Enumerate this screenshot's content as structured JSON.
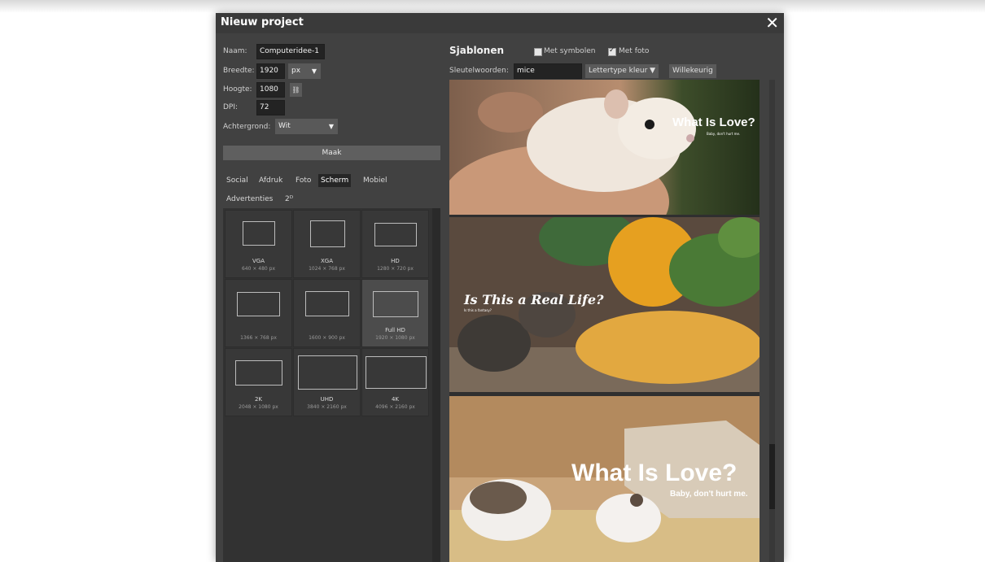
{
  "dialog": {
    "title": "Nieuw project"
  },
  "form": {
    "name_label": "Naam:",
    "name_value": "Computeridee-1",
    "width_label": "Breedte:",
    "width_value": "1920",
    "unit_value": "px",
    "height_label": "Hoogte:",
    "height_value": "1080",
    "dpi_label": "DPI:",
    "dpi_value": "72",
    "background_label": "Achtergrond:",
    "background_value": "Wit",
    "make_button": "Maak"
  },
  "tabs": [
    {
      "label": "Social"
    },
    {
      "label": "Afdruk"
    },
    {
      "label": "Foto"
    },
    {
      "label": "Scherm",
      "active": true
    },
    {
      "label": "Mobiel"
    },
    {
      "label": "Advertenties"
    },
    {
      "label": "2ᴰ"
    }
  ],
  "presets": [
    {
      "name": "VGA",
      "size": "640 × 480 px"
    },
    {
      "name": "XGA",
      "size": "1024 × 768 px"
    },
    {
      "name": "HD",
      "size": "1280 × 720 px"
    },
    {
      "name": "",
      "size": "1366 × 768 px"
    },
    {
      "name": "",
      "size": "1600 × 900 px"
    },
    {
      "name": "Full HD",
      "size": "1920 × 1080 px",
      "selected": true
    },
    {
      "name": "2K",
      "size": "2048 × 1080 px"
    },
    {
      "name": "UHD",
      "size": "3840 × 2160 px"
    },
    {
      "name": "4K",
      "size": "4096 × 2160 px"
    }
  ],
  "templates_panel": {
    "title": "Sjablonen",
    "symbols_label": "Met symbolen",
    "symbols_checked": false,
    "photo_label": "Met foto",
    "photo_checked": true,
    "keywords_label": "Sleutelwoorden:",
    "keywords_value": "mice",
    "font_color_button": "Lettertype kleur ▼",
    "random_button": "Willekeurig"
  },
  "templates": [
    {
      "headline": "What Is Love?",
      "subline": "Baby, don't hurt me."
    },
    {
      "headline": "Is This a Real Life?",
      "subline": "Is this a fantasy?"
    },
    {
      "headline": "What Is Love?",
      "subline": "Baby, don't hurt me."
    }
  ],
  "icons": {
    "close": "close-icon",
    "link": "link-icon",
    "caret": "chevron-down-icon"
  }
}
